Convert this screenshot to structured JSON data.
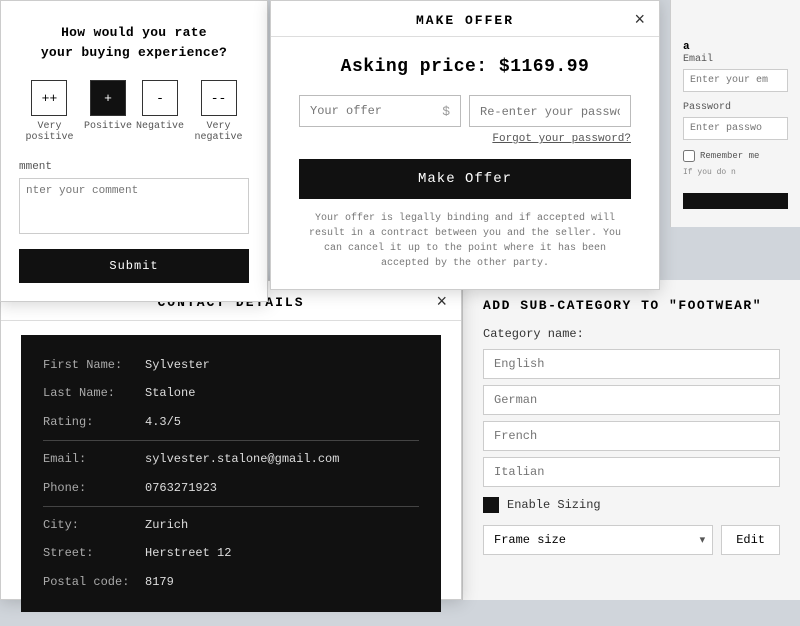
{
  "rate_modal": {
    "title": "How would you rate\nyour buying experience?",
    "options": [
      {
        "symbol": "++",
        "label": "Very positive",
        "selected": false
      },
      {
        "symbol": "+",
        "label": "Positive",
        "selected": true
      },
      {
        "symbol": "-",
        "label": "Negative",
        "selected": false
      },
      {
        "symbol": "--",
        "label": "Very negative",
        "selected": false
      }
    ],
    "comment_label": "mment",
    "comment_placeholder": "nter your comment",
    "submit_label": "Submit"
  },
  "make_offer_modal": {
    "title": "MAKE OFFER",
    "asking_price": "Asking price: $1169.99",
    "offer_placeholder": "Your offer",
    "dollar_sign": "$",
    "password_placeholder": "Re-enter your password",
    "forgot_text": "Forgot your password?",
    "make_offer_label": "Make Offer",
    "legal_text": "Your offer is legally binding and if accepted will result in a contract between you and the seller. You can cancel it up to the point where it has been accepted by the other party.",
    "close": "×"
  },
  "login_partial": {
    "visible_text": "a",
    "email_label": "Email",
    "email_placeholder": "Enter your em",
    "password_label": "Password",
    "password_placeholder": "Enter passwo",
    "remember_label": "Remember me",
    "if_you_note": "If you do n",
    "login_btn": ""
  },
  "contact_modal": {
    "title": "CONTACT DETAILS",
    "close": "×",
    "fields": [
      {
        "key": "First Name:",
        "value": "Sylvester"
      },
      {
        "key": "Last Name:",
        "value": "Stalone"
      },
      {
        "key": "Rating:",
        "value": "4.3/5"
      },
      {
        "key": "Email:",
        "value": "sylvester.stalone@gmail.com",
        "divider": true
      },
      {
        "key": "Phone:",
        "value": "0763271923"
      },
      {
        "key": "City:",
        "value": "Zurich",
        "divider2": true
      },
      {
        "key": "Street:",
        "value": "Herstreet 12"
      },
      {
        "key": "Postal code:",
        "value": "8179"
      }
    ]
  },
  "subcategory_modal": {
    "title": "ADD SUB-CATEGORY TO \"FOOTWEAR\"",
    "category_name_label": "Category name:",
    "languages": [
      "English",
      "German",
      "French",
      "Italian"
    ],
    "enable_sizing_label": "Enable Sizing",
    "frame_size_label": "Frame size",
    "edit_label": "Edit"
  }
}
